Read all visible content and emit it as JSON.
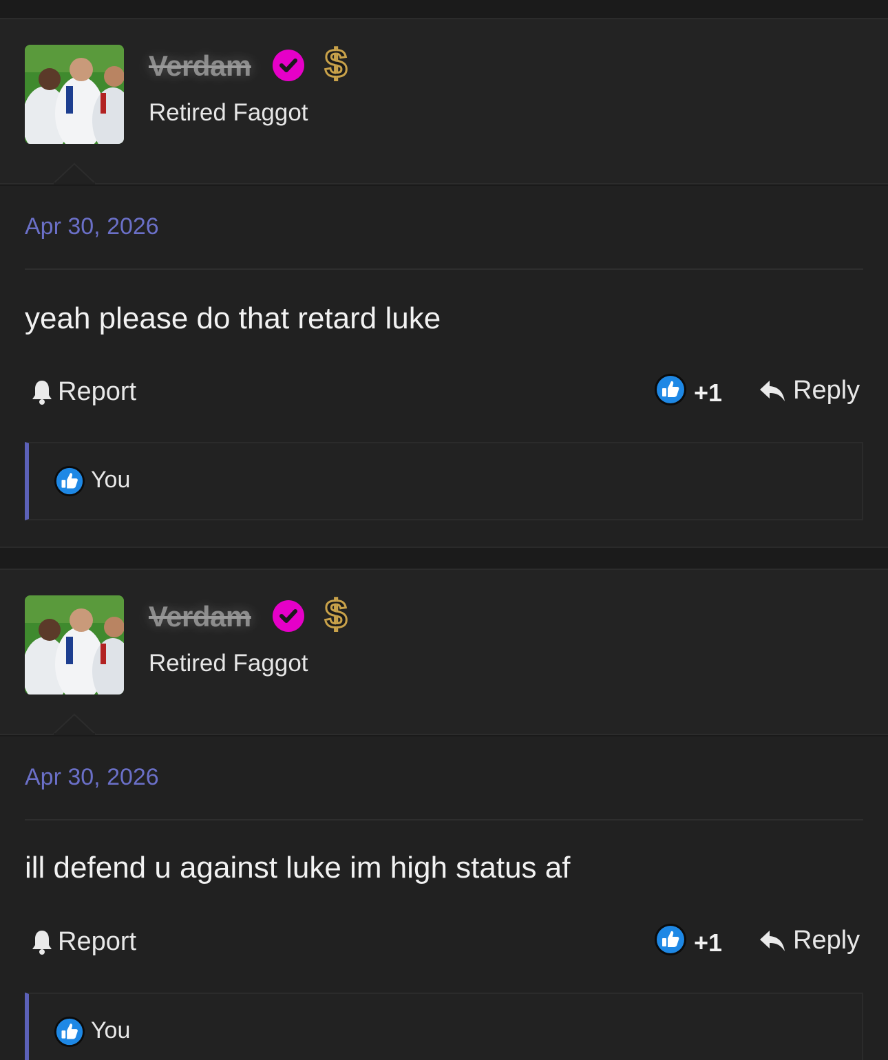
{
  "posts": [
    {
      "username": "Verdam",
      "user_title": "Retired Faggot",
      "date": "Apr 30, 2026",
      "message": "yeah please do that retard luke",
      "report_label": "Report",
      "like_count": "+1",
      "reply_label": "Reply",
      "liked_by": "You"
    },
    {
      "username": "Verdam",
      "user_title": "Retired Faggot",
      "date": "Apr 30, 2026",
      "message": "ill defend u against luke im high status af",
      "report_label": "Report",
      "like_count": "+1",
      "reply_label": "Reply",
      "liked_by": "You"
    }
  ],
  "colors": {
    "verified_badge": "#e600c8",
    "date_accent": "#6b70c8",
    "like_blue": "#1e88e5",
    "dollar_gold": "#c9a24a"
  },
  "icons": [
    "verified-check-icon",
    "dollar-icon",
    "bell-icon",
    "like-icon",
    "reply-arrow-icon"
  ]
}
